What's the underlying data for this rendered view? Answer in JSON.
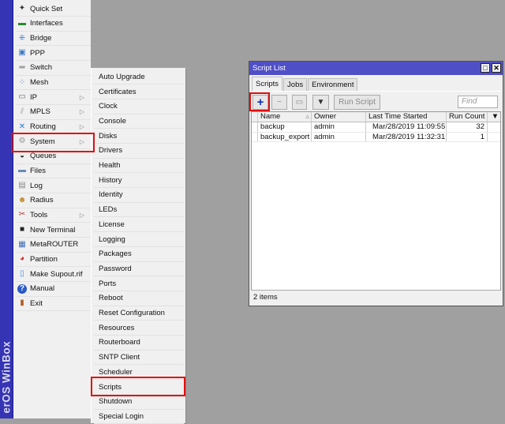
{
  "brand": "erOS WinBox",
  "main_menu": [
    {
      "label": "Quick Set",
      "icon": "quick-set-icon",
      "glyph": "✦",
      "color": "#333"
    },
    {
      "label": "Interfaces",
      "icon": "interfaces-icon",
      "glyph": "▬",
      "color": "#2a8a2a"
    },
    {
      "label": "Bridge",
      "icon": "bridge-icon",
      "glyph": "⁜",
      "color": "#2a7ad8"
    },
    {
      "label": "PPP",
      "icon": "ppp-icon",
      "glyph": "▣",
      "color": "#3a7ac8"
    },
    {
      "label": "Switch",
      "icon": "switch-icon",
      "glyph": "═",
      "color": "#555"
    },
    {
      "label": "Mesh",
      "icon": "mesh-icon",
      "glyph": "⁘",
      "color": "#3a7ac8"
    },
    {
      "label": "IP",
      "icon": "ip-icon",
      "glyph": "▭",
      "color": "#666",
      "submenu": true
    },
    {
      "label": "MPLS",
      "icon": "mpls-icon",
      "glyph": "⫽",
      "color": "#999",
      "submenu": true
    },
    {
      "label": "Routing",
      "icon": "routing-icon",
      "glyph": "✕",
      "color": "#2a7ad8",
      "submenu": true
    },
    {
      "label": "System",
      "icon": "gear-icon",
      "glyph": "⚙",
      "color": "#999",
      "submenu": true
    },
    {
      "label": "Queues",
      "icon": "queues-icon",
      "glyph": "◒",
      "color": "#333"
    },
    {
      "label": "Files",
      "icon": "folder-icon",
      "glyph": "▬",
      "color": "#6a8ab8"
    },
    {
      "label": "Log",
      "icon": "log-icon",
      "glyph": "▤",
      "color": "#888"
    },
    {
      "label": "Radius",
      "icon": "radius-icon",
      "glyph": "☻",
      "color": "#c08a30"
    },
    {
      "label": "Tools",
      "icon": "tools-icon",
      "glyph": "✂",
      "color": "#c03030",
      "submenu": true
    },
    {
      "label": "New Terminal",
      "icon": "terminal-icon",
      "glyph": "■",
      "color": "#222"
    },
    {
      "label": "MetaROUTER",
      "icon": "metarouter-icon",
      "glyph": "▦",
      "color": "#3a6ab8"
    },
    {
      "label": "Partition",
      "icon": "partition-icon",
      "glyph": "◕",
      "color": "#d03030"
    },
    {
      "label": "Make Supout.rif",
      "icon": "supout-icon",
      "glyph": "▯",
      "color": "#3a8ad8"
    },
    {
      "label": "Manual",
      "icon": "help-icon",
      "glyph": "?",
      "color": "#fff"
    },
    {
      "label": "Exit",
      "icon": "exit-icon",
      "glyph": "▮",
      "color": "#b0602a"
    }
  ],
  "system_submenu": [
    "Auto Upgrade",
    "Certificates",
    "Clock",
    "Console",
    "Disks",
    "Drivers",
    "Health",
    "History",
    "Identity",
    "LEDs",
    "License",
    "Logging",
    "Packages",
    "Password",
    "Ports",
    "Reboot",
    "Reset Configuration",
    "Resources",
    "Routerboard",
    "SNTP Client",
    "Scheduler",
    "Scripts",
    "Shutdown",
    "Special Login"
  ],
  "highlighted": {
    "main_menu": "System",
    "submenu": "Scripts",
    "toolbar": "add"
  },
  "highlight_color": "#e01010",
  "window": {
    "title": "Script List",
    "tabs": [
      "Scripts",
      "Jobs",
      "Environment"
    ],
    "active_tab": "Scripts",
    "toolbar": {
      "add": "+",
      "remove": "−",
      "comment": "▭",
      "filter": "▼",
      "run": "Run Script",
      "find_placeholder": "Find"
    },
    "columns": [
      "Name",
      "Owner",
      "Last Time Started",
      "Run Count"
    ],
    "sort_indicator": "▵",
    "rows": [
      {
        "name": "backup",
        "owner": "admin",
        "last": "Mar/28/2019 11:09:55",
        "count": "32"
      },
      {
        "name": "backup_export",
        "owner": "admin",
        "last": "Mar/28/2019 11:32:31",
        "count": "1"
      }
    ],
    "status": "2 items"
  }
}
